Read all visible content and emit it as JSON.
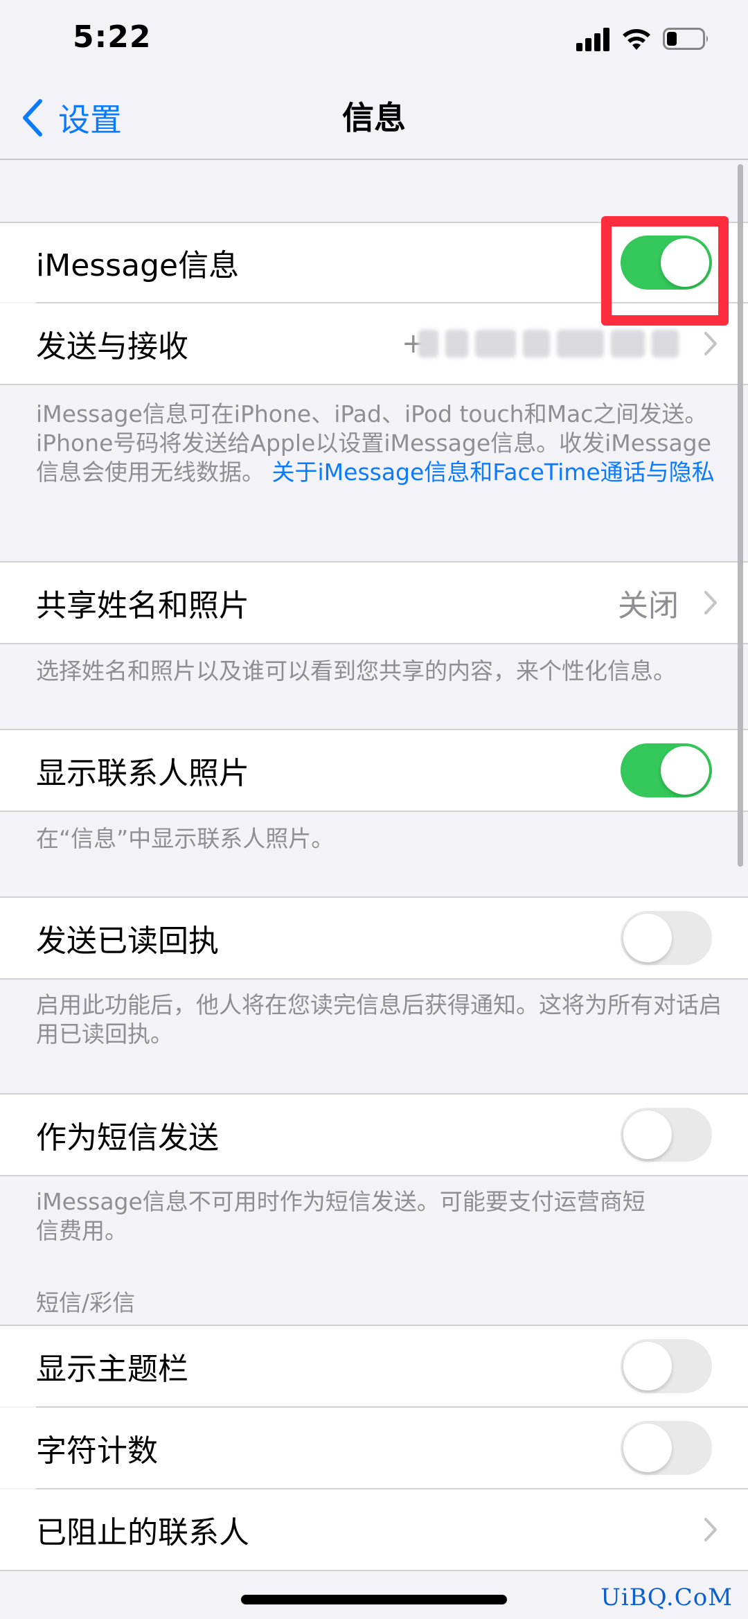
{
  "status_bar": {
    "time": "5:22"
  },
  "nav": {
    "back_label": "设置",
    "title": "信息"
  },
  "rows": {
    "imessage": {
      "label": "iMessage信息",
      "toggle": "on"
    },
    "send_receive": {
      "label": "发送与接收",
      "value_visible_prefix": "+"
    },
    "share_name": {
      "label": "共享姓名和照片",
      "value": "关闭"
    },
    "contact_photos": {
      "label": "显示联系人照片",
      "toggle": "on"
    },
    "read_receipts": {
      "label": "发送已读回执",
      "toggle": "off"
    },
    "send_as_sms": {
      "label": "作为短信发送",
      "toggle": "off"
    },
    "subject_field": {
      "label": "显示主题栏",
      "toggle": "off"
    },
    "char_count": {
      "label": "字符计数",
      "toggle": "off"
    },
    "blocked": {
      "label": "已阻止的联系人"
    }
  },
  "footers": {
    "imessage_text": "iMessage信息可在iPhone、iPad、iPod touch和Mac之间发送。iPhone号码将发送给Apple以设置iMessage信息。收发iMessage信息会使用无线数据。",
    "imessage_link": "关于iMessage信息和FaceTime通话与隐私",
    "share_name": "选择姓名和照片以及谁可以看到您共享的内容，来个性化信息。",
    "contact_photos": "在“信息”中显示联系人照片。",
    "read_receipts": "启用此功能后，他人将在您读完信息后获得通知。这将为所有对话启用已读回执。",
    "send_as_sms": "iMessage信息不可用时作为短信发送。可能要支付运营商短信费用。"
  },
  "section_headers": {
    "sms_mms": "短信/彩信"
  },
  "watermark": "UiBQ.CoM",
  "colors": {
    "accent": "#0a7aff",
    "toggle_on": "#34c759",
    "highlight": "#ff2d3d"
  }
}
